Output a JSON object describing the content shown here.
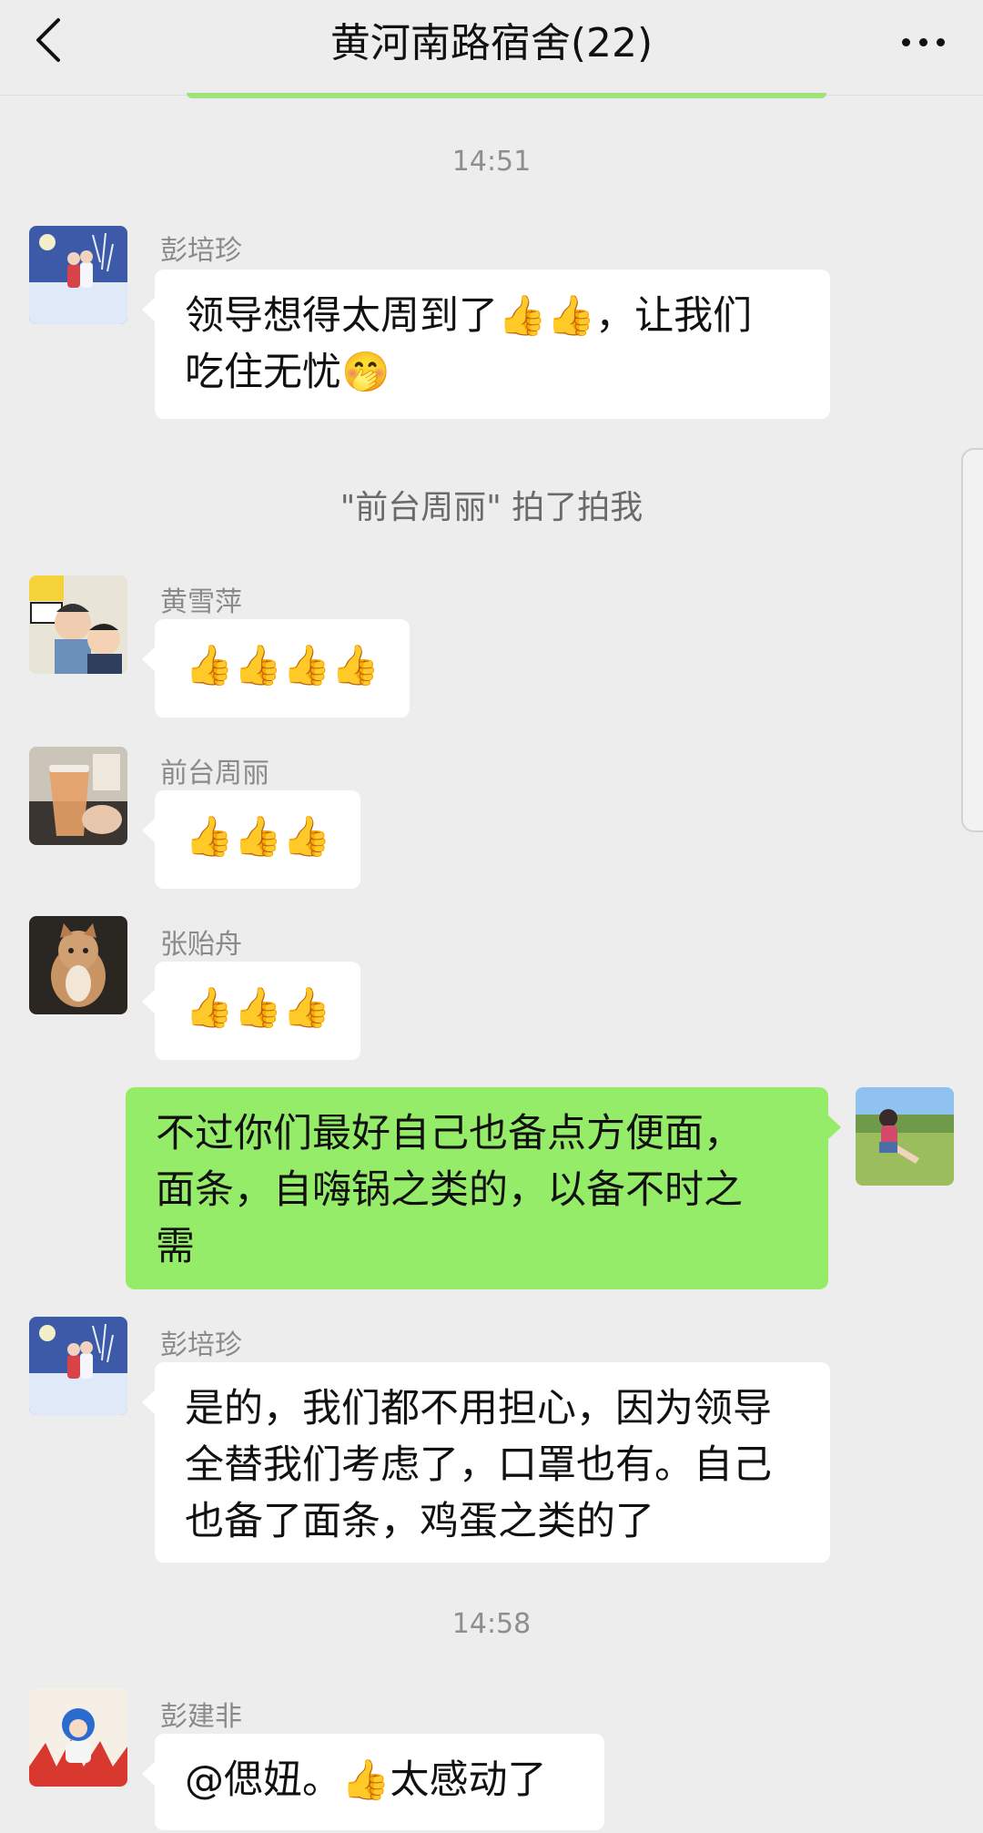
{
  "header": {
    "title": "黄河南路宿舍(22)"
  },
  "timestamps": [
    "14:51",
    "14:58"
  ],
  "system_message": "\"前台周丽\" 拍了拍我",
  "emoji": {
    "thumbs_up": "👍",
    "shy_face": "🤭"
  },
  "messages": [
    {
      "sender": "彭培珍",
      "lines": [
        "领导想得太周到了👍👍，让我们",
        "吃住无忧🤭"
      ]
    },
    {
      "sender": "黄雪萍",
      "lines": [
        "👍👍👍👍"
      ]
    },
    {
      "sender": "前台周丽",
      "lines": [
        "👍👍👍"
      ]
    },
    {
      "sender": "张贻舟",
      "lines": [
        "👍👍👍"
      ]
    },
    {
      "sender": "",
      "self": true,
      "lines": [
        "不过你们最好自己也备点方便面，",
        "面条，自嗨锅之类的，以备不时之",
        "需"
      ]
    },
    {
      "sender": "彭培珍",
      "lines": [
        "是的，我们都不用担心，因为领导",
        "全替我们考虑了，口罩也有。自己",
        "也备了面条，鸡蛋之类的了"
      ]
    },
    {
      "sender": "彭建非",
      "lines": [
        "@偲妞。👍太感动了"
      ]
    }
  ],
  "colors": {
    "background": "#ededed",
    "bubble_other": "#ffffff",
    "bubble_self": "#95ec69"
  }
}
